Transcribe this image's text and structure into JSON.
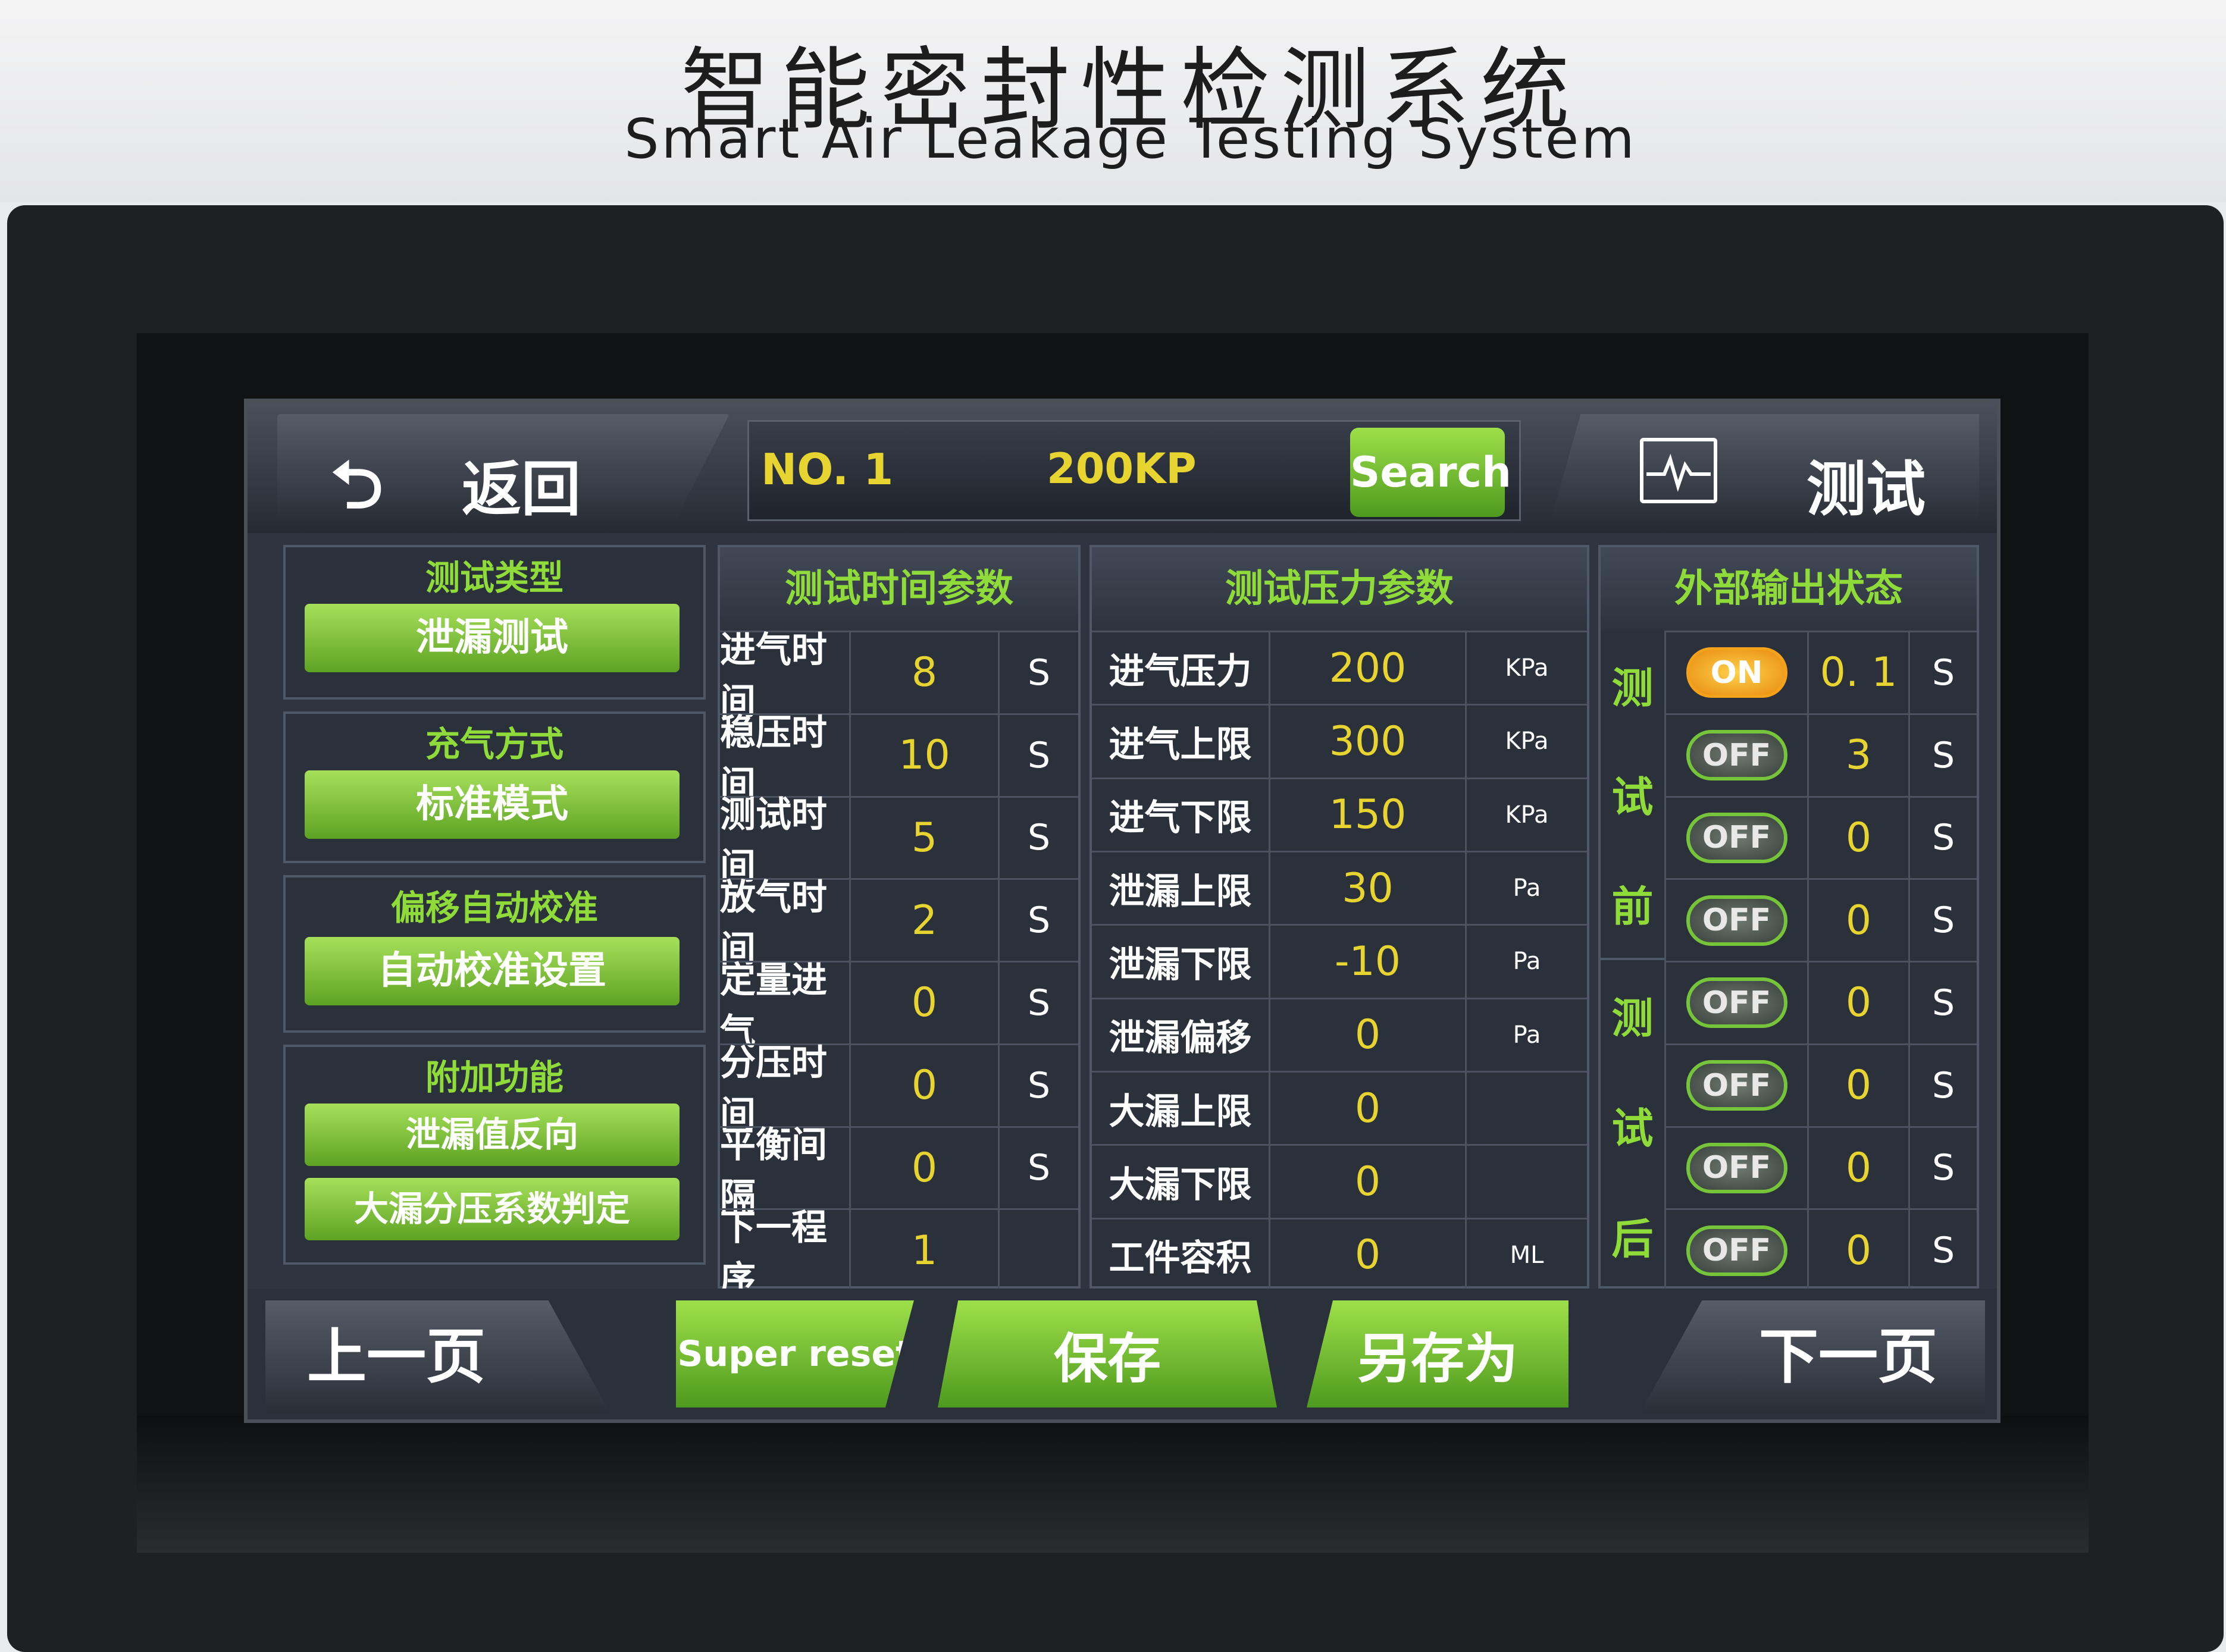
{
  "device": {
    "title_cn": "智能密封性检测系统",
    "title_en": "Smart Air Leakage Testing System"
  },
  "topbar": {
    "back_label": "返回",
    "program_no": "NO. 1",
    "program_name": "200KP",
    "search_label": "Search",
    "test_label": "测试"
  },
  "left": {
    "test_type": {
      "title": "测试类型",
      "button": "泄漏测试"
    },
    "fill_mode": {
      "title": "充气方式",
      "button": "标准模式"
    },
    "offset_cal": {
      "title": "偏移自动校准",
      "button": "自动校准设置"
    },
    "extra": {
      "title": "附加功能",
      "button1": "泄漏值反向",
      "button2": "大漏分压系数判定"
    }
  },
  "time_params": {
    "title": "测试时间参数",
    "rows": [
      {
        "label": "进气时间",
        "value": "8",
        "unit": "S"
      },
      {
        "label": "稳压时间",
        "value": "10",
        "unit": "S"
      },
      {
        "label": "测试时间",
        "value": "5",
        "unit": "S"
      },
      {
        "label": "放气时间",
        "value": "2",
        "unit": "S"
      },
      {
        "label": "定量进气",
        "value": "0",
        "unit": "S"
      },
      {
        "label": "分压时间",
        "value": "0",
        "unit": "S"
      },
      {
        "label": "平衡间隔",
        "value": "0",
        "unit": "S"
      },
      {
        "label": "下一程序",
        "value": "1",
        "unit": ""
      }
    ]
  },
  "pressure_params": {
    "title": "测试压力参数",
    "rows": [
      {
        "label": "进气压力",
        "value": "200",
        "unit": "KPa"
      },
      {
        "label": "进气上限",
        "value": "300",
        "unit": "KPa"
      },
      {
        "label": "进气下限",
        "value": "150",
        "unit": "KPa"
      },
      {
        "label": "泄漏上限",
        "value": "30",
        "unit": "Pa"
      },
      {
        "label": "泄漏下限",
        "value": "-10",
        "unit": "Pa"
      },
      {
        "label": "泄漏偏移",
        "value": "0",
        "unit": "Pa"
      },
      {
        "label": "大漏上限",
        "value": "0",
        "unit": ""
      },
      {
        "label": "大漏下限",
        "value": "0",
        "unit": ""
      },
      {
        "label": "工件容积",
        "value": "0",
        "unit": "ML"
      }
    ]
  },
  "output": {
    "title": "外部输出状态",
    "before_label": [
      "测",
      "试",
      "前"
    ],
    "after_label": [
      "测",
      "试",
      "后"
    ],
    "rows": [
      {
        "state": "ON",
        "value": "0. 1",
        "unit": "S"
      },
      {
        "state": "OFF",
        "value": "3",
        "unit": "S"
      },
      {
        "state": "OFF",
        "value": "0",
        "unit": "S"
      },
      {
        "state": "OFF",
        "value": "0",
        "unit": "S"
      },
      {
        "state": "OFF",
        "value": "0",
        "unit": "S"
      },
      {
        "state": "OFF",
        "value": "0",
        "unit": "S"
      },
      {
        "state": "OFF",
        "value": "0",
        "unit": "S"
      },
      {
        "state": "OFF",
        "value": "0",
        "unit": "S"
      }
    ]
  },
  "bottombar": {
    "prev_label": "上一页",
    "reset_label": "Super reset",
    "save_label": "保存",
    "save_as_label": "另存为",
    "next_label": "下一页"
  },
  "colors": {
    "accent_green": "#8fdb3a",
    "value_yellow": "#e8d430",
    "on_orange": "#f4a21a"
  }
}
